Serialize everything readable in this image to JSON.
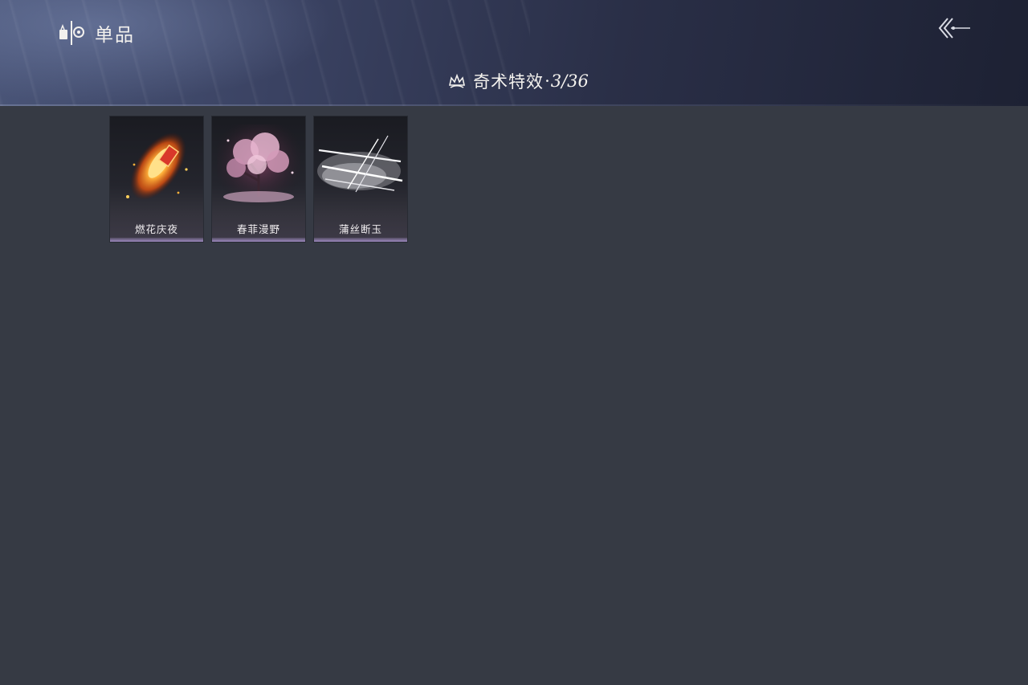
{
  "header": {
    "breadcrumb_title": "单品",
    "breadcrumb_icon": "item-icon",
    "back_icon": "back-arrow-icon"
  },
  "category": {
    "icon": "crown-icon",
    "name": "奇术特效",
    "separator": "·",
    "count": "3/36"
  },
  "items": [
    {
      "label": "燃花庆夜",
      "art": "firework-effect-art",
      "accent": "#ff8a1e"
    },
    {
      "label": "春菲漫野",
      "art": "cherry-blossom-effect-art",
      "accent": "#c88aa8"
    },
    {
      "label": "蒲丝断玉",
      "art": "silver-slash-effect-art",
      "accent": "#dcdce0"
    }
  ],
  "colors": {
    "page_bg": "#363a44",
    "header_bg": "#2a2f47",
    "card_bar": "#9f8ac0",
    "text": "#f3f1ee"
  }
}
